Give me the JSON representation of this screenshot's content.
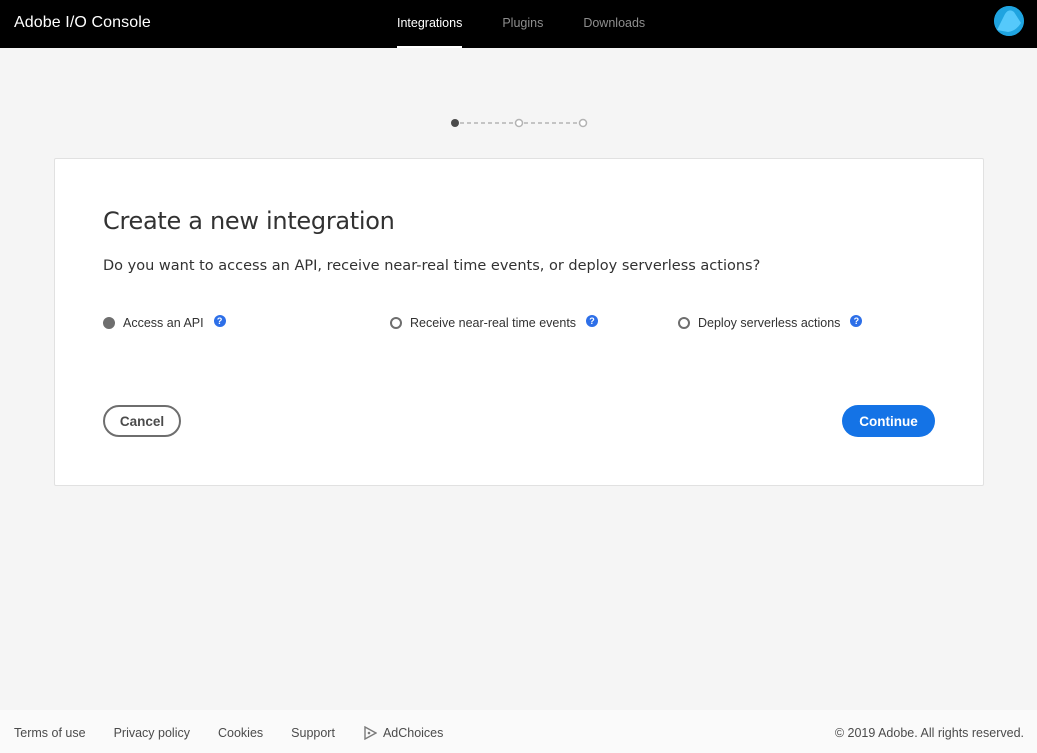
{
  "app": {
    "title": "Adobe I/O Console"
  },
  "nav": {
    "items": [
      {
        "label": "Integrations",
        "active": true
      },
      {
        "label": "Plugins",
        "active": false
      },
      {
        "label": "Downloads",
        "active": false
      }
    ]
  },
  "stepper": {
    "total_steps": 3,
    "current_step": 1
  },
  "card": {
    "title": "Create a new integration",
    "question": "Do you want to access an API, receive near-real time events, or deploy serverless actions?",
    "options": [
      {
        "label": "Access an API",
        "selected": true
      },
      {
        "label": "Receive near-real time events",
        "selected": false
      },
      {
        "label": "Deploy serverless actions",
        "selected": false
      }
    ],
    "help_glyph": "?",
    "cancel_label": "Cancel",
    "continue_label": "Continue"
  },
  "footer": {
    "links": [
      "Terms of use",
      "Privacy policy",
      "Cookies",
      "Support",
      "AdChoices"
    ],
    "copyright": "© 2019 Adobe. All rights reserved."
  },
  "colors": {
    "topbar": "#000000",
    "accent": "#1473e6",
    "help_icon": "#2d6fe8",
    "avatar": "#1fa4e0"
  },
  "icons": {
    "avatar": "user-avatar-icon",
    "help": "help-question-icon",
    "adchoices": "adchoices-icon"
  }
}
